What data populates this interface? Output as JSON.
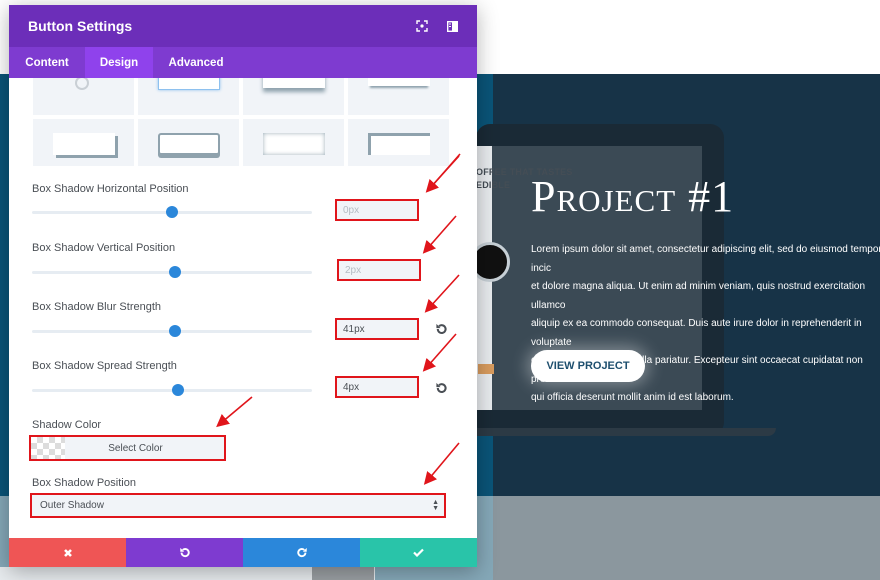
{
  "modal": {
    "title": "Button Settings",
    "header_icons": [
      "fullscreen-icon",
      "sidebar-toggle-icon"
    ],
    "tabs": [
      {
        "label": "Content",
        "active": false
      },
      {
        "label": "Design",
        "active": true
      },
      {
        "label": "Advanced",
        "active": false
      }
    ],
    "box_shadow_presets": [
      "none",
      "preset-1",
      "preset-2",
      "preset-3",
      "preset-4",
      "preset-5",
      "preset-6",
      "preset-7"
    ],
    "fields": {
      "horizontal": {
        "label": "Box Shadow Horizontal Position",
        "value": "0px",
        "is_placeholder": true,
        "slider_fraction": 0.5
      },
      "vertical": {
        "label": "Box Shadow Vertical Position",
        "value": "2px",
        "is_placeholder": true,
        "slider_fraction": 0.51
      },
      "blur": {
        "label": "Box Shadow Blur Strength",
        "value": "41px",
        "is_placeholder": false,
        "slider_fraction": 0.51,
        "has_reset": true
      },
      "spread": {
        "label": "Box Shadow Spread Strength",
        "value": "4px",
        "is_placeholder": false,
        "slider_fraction": 0.52,
        "has_reset": true
      },
      "shadow_color": {
        "label": "Shadow Color",
        "button_label": "Select Color"
      },
      "position": {
        "label": "Box Shadow Position",
        "selected": "Outer Shadow"
      }
    },
    "footer": {
      "buttons": [
        {
          "name": "discard",
          "icon": "close-icon",
          "color": "#ef5555"
        },
        {
          "name": "undo",
          "icon": "undo-icon",
          "color": "#7e3bd0"
        },
        {
          "name": "redo",
          "icon": "redo-icon",
          "color": "#2b87da"
        },
        {
          "name": "save",
          "icon": "check-icon",
          "color": "#29c4a9"
        }
      ]
    },
    "colors": {
      "header": "#6c2eb9",
      "tabs": "#7e3bd0",
      "active_tab": "#8f42ec",
      "slider": "#2b87da",
      "highlight": "#e0151b"
    }
  },
  "page": {
    "hero": {
      "title": "Project #1",
      "body": "Lorem ipsum dolor sit amet, consectetur adipiscing elit, sed do eiusmod tempor incic\net dolore magna aliqua. Ut enim ad minim veniam, quis nostrud exercitation ullamco\naliquip ex ea commodo consequat. Duis aute irure dolor in reprehenderit in voluptate\ncillum dolore eu fugiat nulla pariatur. Excepteur sint occaecat cupidatat non proident\nqui officia deserunt mollit anim id est laborum.",
      "button_label": "VIEW PROJECT"
    },
    "mockup_text": "OFFEE THAT TASTES\nEDIBLE"
  }
}
